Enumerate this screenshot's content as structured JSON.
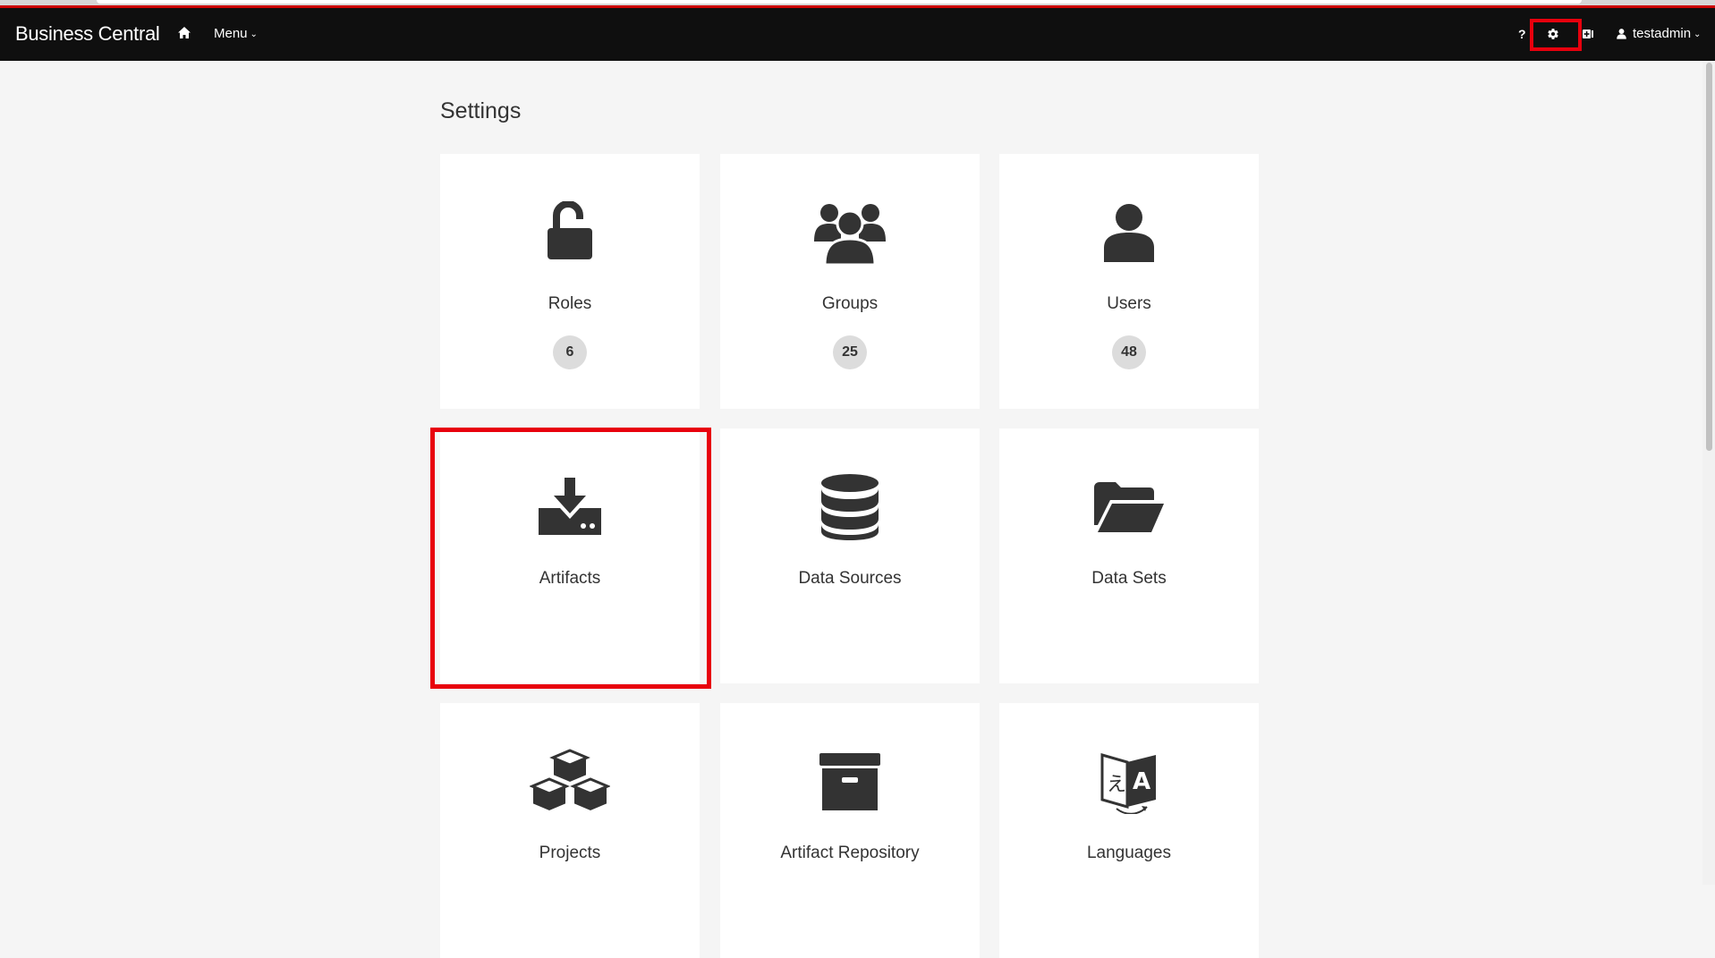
{
  "app": {
    "brand": "Business Central"
  },
  "navbar": {
    "menu_label": "Menu",
    "help_label": "?",
    "user_label": "testadmin",
    "icons": {
      "home": "home-icon",
      "settings": "gear-icon",
      "addon": "plus-square-icon",
      "user": "user-icon",
      "chevron": "chevron-down-icon"
    }
  },
  "page": {
    "title": "Settings"
  },
  "cards": [
    {
      "key": "roles",
      "label": "Roles",
      "count": "6",
      "icon": "lock-open-icon"
    },
    {
      "key": "groups",
      "label": "Groups",
      "count": "25",
      "icon": "users-icon"
    },
    {
      "key": "users",
      "label": "Users",
      "count": "48",
      "icon": "user-icon"
    },
    {
      "key": "artifacts",
      "label": "Artifacts",
      "icon": "download-icon"
    },
    {
      "key": "data-sources",
      "label": "Data Sources",
      "icon": "database-icon"
    },
    {
      "key": "data-sets",
      "label": "Data Sets",
      "icon": "folder-open-icon"
    },
    {
      "key": "projects",
      "label": "Projects",
      "icon": "cubes-icon"
    },
    {
      "key": "artifact-repository",
      "label": "Artifact Repository",
      "icon": "archive-icon"
    },
    {
      "key": "languages",
      "label": "Languages",
      "icon": "language-icon"
    }
  ],
  "colors": {
    "navbar_bg": "#0f0f0f",
    "highlight": "#e8000d",
    "accent_red": "#cc0000",
    "page_bg": "#f5f5f5",
    "icon": "#333333",
    "badge_bg": "#dcdcdc"
  }
}
